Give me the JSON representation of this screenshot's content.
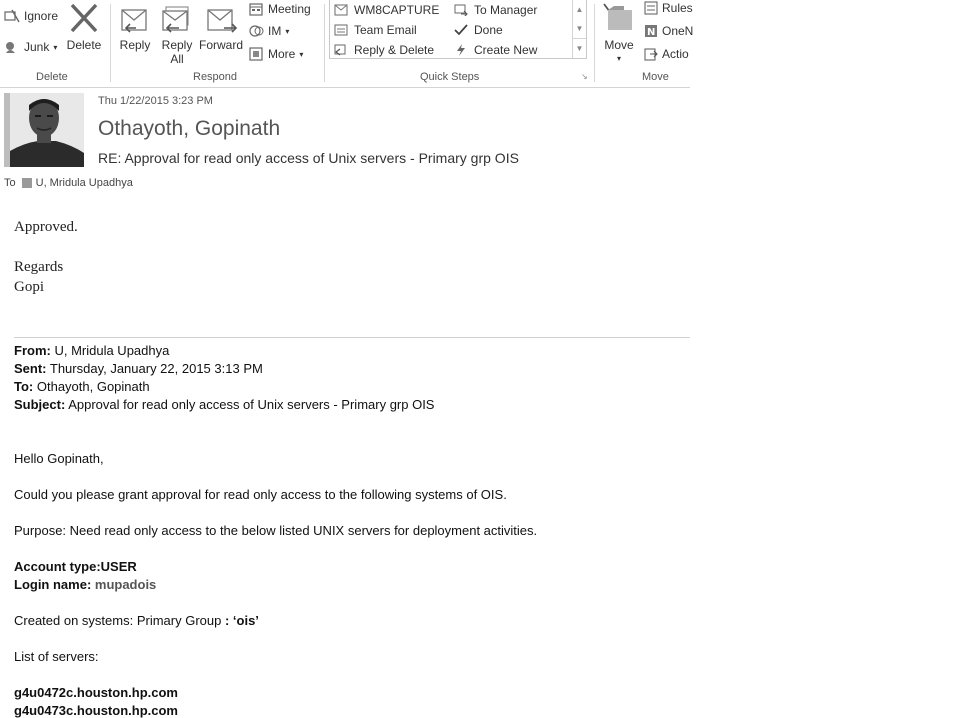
{
  "ribbon": {
    "delete_group": {
      "ignore": "Ignore",
      "junk": "Junk",
      "delete": "Delete",
      "label": "Delete"
    },
    "respond_group": {
      "reply": "Reply",
      "reply_all_1": "Reply",
      "reply_all_2": "All",
      "forward": "Forward",
      "meeting": "Meeting",
      "im": "IM",
      "more": "More",
      "label": "Respond"
    },
    "quick_steps": {
      "items": [
        "WM8CAPTURE",
        "Team Email",
        "Reply & Delete",
        "To Manager",
        "Done",
        "Create New"
      ],
      "label": "Quick Steps"
    },
    "move_group": {
      "move": "Move",
      "rules": "Rules",
      "onenote": "OneN",
      "actions": "Actio",
      "label": "Move"
    }
  },
  "message": {
    "date": "Thu 1/22/2015 3:23 PM",
    "from": "Othayoth, Gopinath",
    "subject": "RE: Approval for read only access of Unix servers - Primary grp OIS",
    "to_label": "To",
    "to": "U, Mridula Upadhya"
  },
  "reply_body": {
    "approved": "Approved.",
    "regards": "Regards",
    "name": "Gopi"
  },
  "quoted_header": {
    "from_label": "From:",
    "from": " U, Mridula Upadhya",
    "sent_label": "Sent:",
    "sent": " Thursday, January 22, 2015 3:13 PM",
    "to_label": "To:",
    "to": " Othayoth, Gopinath",
    "subject_label": "Subject:",
    "subject": " Approval for read only access of Unix servers - Primary grp OIS"
  },
  "quoted_body": {
    "greeting": "Hello Gopinath,",
    "request": "Could you please grant approval for read only access to the following systems of OIS.",
    "purpose": "Purpose: Need read only access to the below listed UNIX servers for deployment activities.",
    "account_type_label": "Account type:",
    "account_type": "USER",
    "login_label": "Login name: ",
    "login": "mupadois",
    "created_prefix": "Created on systems: Primary Group ",
    "created_group": ": ‘ois’",
    "servers_label": "List of servers:",
    "servers": [
      "g4u0472c.houston.hp.com",
      "g4u0473c.houston.hp.com"
    ]
  }
}
